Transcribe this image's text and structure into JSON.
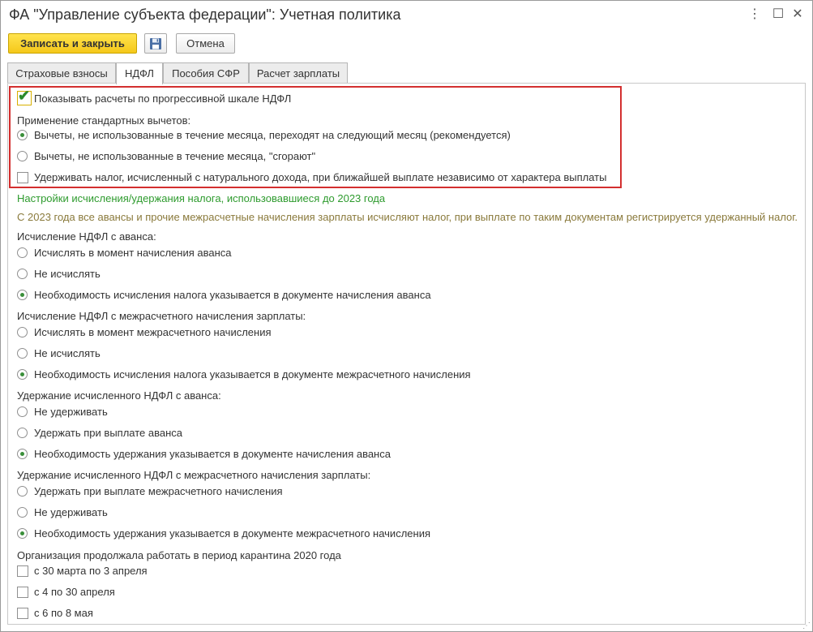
{
  "window": {
    "title": "ФА \"Управление субъекта федерации\": Учетная политика",
    "menu_icon": "⋮",
    "minimize_icon": "–",
    "maximize_icon": "☐",
    "close_icon": "✕"
  },
  "toolbar": {
    "save_close_label": "Записать и закрыть",
    "cancel_label": "Отмена",
    "save_icon": "floppy-disk-icon"
  },
  "tabs": [
    {
      "label": "Страховые взносы",
      "active": false
    },
    {
      "label": "НДФЛ",
      "active": true
    },
    {
      "label": "Пособия СФР",
      "active": false
    },
    {
      "label": "Расчет зарплаты",
      "active": false
    }
  ],
  "progressive": {
    "label": "Показывать расчеты по прогрессивной шкале НДФЛ",
    "checked": true
  },
  "deductions": {
    "heading": "Применение стандартных вычетов:",
    "option1": "Вычеты, не использованные в течение месяца, переходят на следующий месяц (рекомендуется)",
    "option2": "Вычеты, не использованные в течение месяца, \"сгорают\"",
    "selected": 1
  },
  "natural_income": {
    "label": "Удерживать налог, исчисленный с натурального дохода, при ближайшей выплате независимо от характера выплаты",
    "checked": false
  },
  "legacy": {
    "link": "Настройки исчисления/удержания налога, использовавшиеся до 2023 года",
    "note": "С 2023 года все авансы и прочие межрасчетные начисления зарплаты исчисляют налог, при выплате по таким документам регистрируется удержанный налог."
  },
  "advance_calc": {
    "heading": "Исчисление НДФЛ с аванса:",
    "options": [
      "Исчислять в момент начисления аванса",
      "Не исчислять",
      "Необходимость исчисления налога указывается в документе начисления аванса"
    ],
    "selected": 2
  },
  "interim_calc": {
    "heading": "Исчисление НДФЛ с межрасчетного начисления зарплаты:",
    "options": [
      "Исчислять в момент межрасчетного начисления",
      "Не исчислять",
      "Необходимость исчисления налога указывается в документе межрасчетного начисления"
    ],
    "selected": 2
  },
  "advance_withhold": {
    "heading": "Удержание исчисленного НДФЛ с аванса:",
    "options": [
      "Не удерживать",
      "Удержать при выплате аванса",
      "Необходимость удержания указывается в документе начисления аванса"
    ],
    "selected": 2
  },
  "interim_withhold": {
    "heading": "Удержание исчисленного НДФЛ с межрасчетного начисления зарплаты:",
    "options": [
      "Удержать при выплате межрасчетного начисления",
      "Не удерживать",
      "Необходимость удержания указывается в документе межрасчетного начисления"
    ],
    "selected": 2
  },
  "quarantine": {
    "heading": "Организация продолжала работать в период карантина 2020 года",
    "options": [
      "с 30 марта по 3 апреля",
      "с 4 по 30 апреля",
      "с 6 по 8 мая"
    ]
  },
  "colors": {
    "accent_yellow": "#f5c81a",
    "highlight_red": "#d32f2f",
    "link_green": "#2e9b2e",
    "note_olive": "#8a7a3c"
  }
}
